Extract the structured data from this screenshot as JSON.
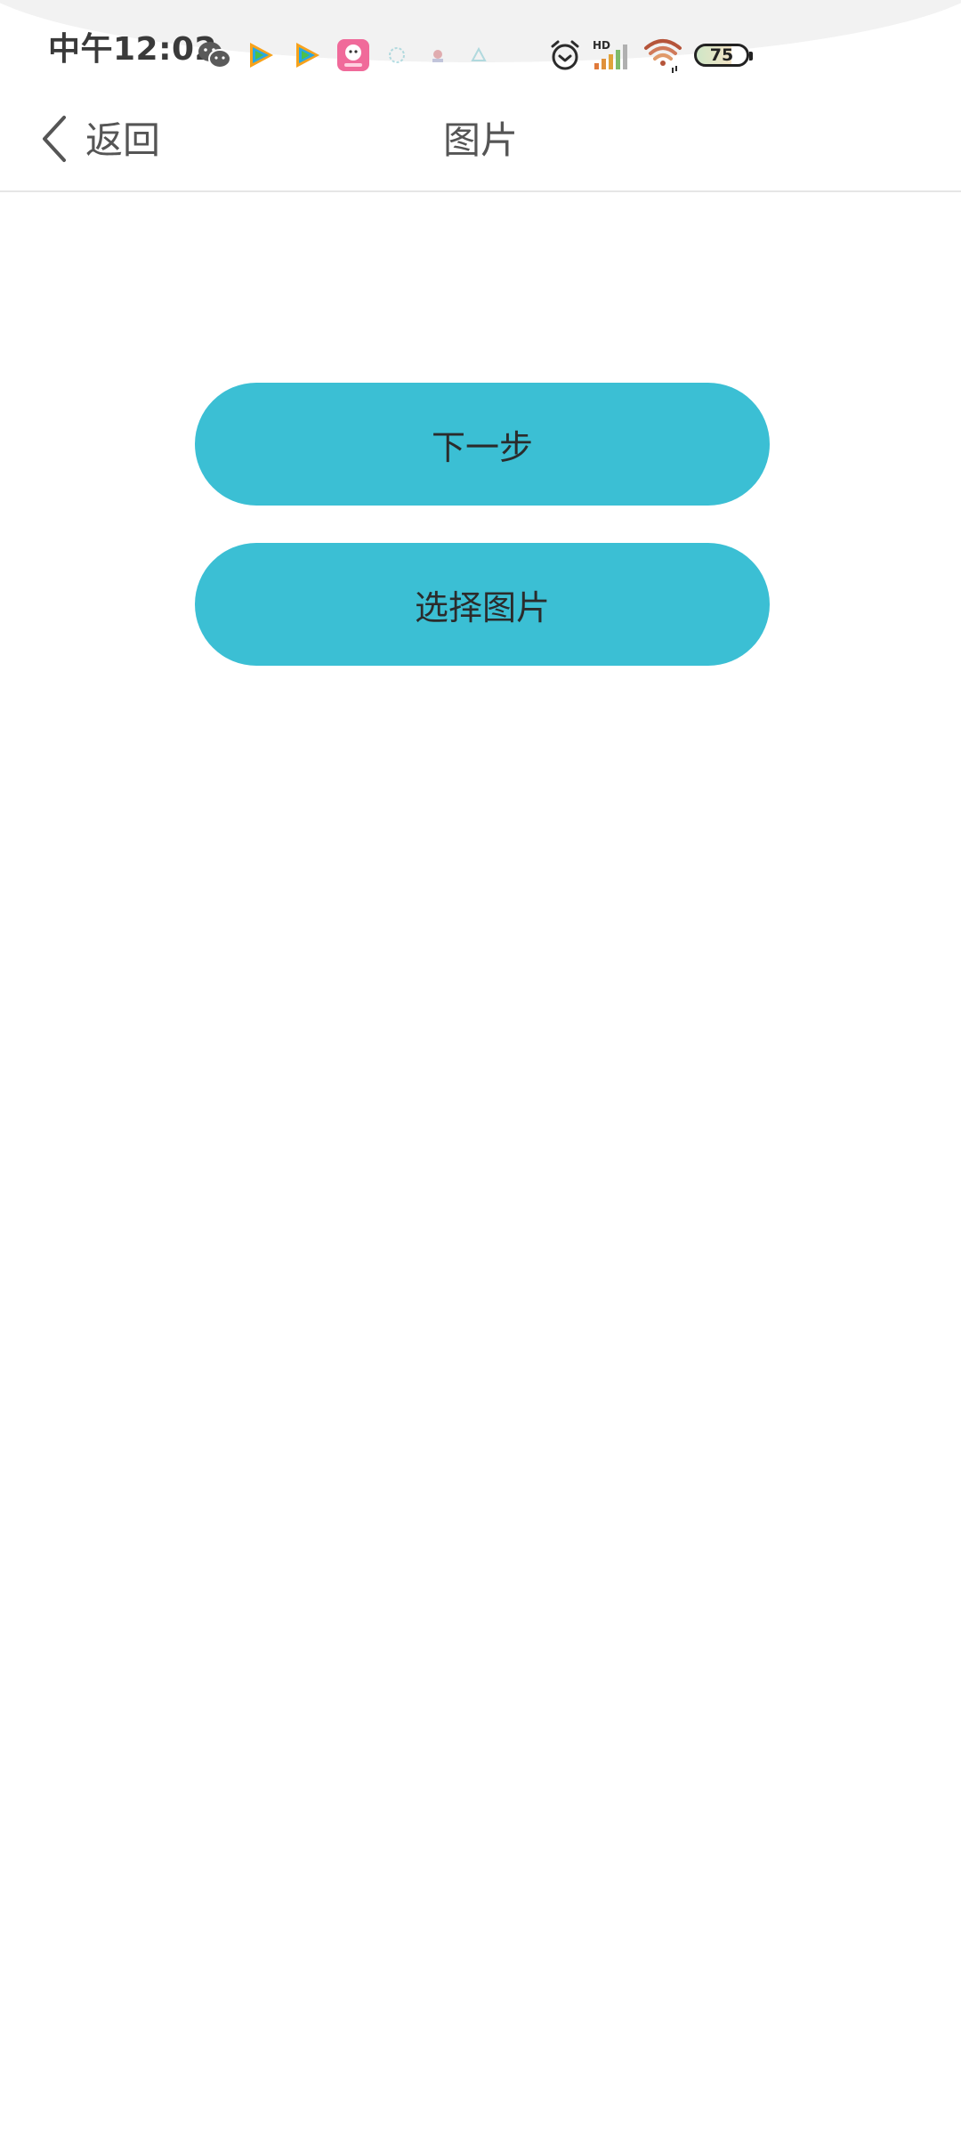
{
  "status_bar": {
    "time": "中午12:02",
    "notification_icons": [
      "wechat-icon",
      "tencent-video-icon",
      "tencent-video-icon",
      "pink-app-icon",
      "faint-app-icon",
      "faint-app-icon",
      "faint-app-icon"
    ],
    "system_icons": [
      "alarm-icon",
      "hd-signal-icon",
      "wifi-icon"
    ],
    "signal_label": "HD",
    "battery_level": "75"
  },
  "header": {
    "back_label": "返回",
    "title": "图片"
  },
  "actions": {
    "next_label": "下一步",
    "select_image_label": "选择图片"
  },
  "colors": {
    "accent": "#3bbfd4",
    "text": "#555555",
    "button_text": "#2b2b2b"
  }
}
